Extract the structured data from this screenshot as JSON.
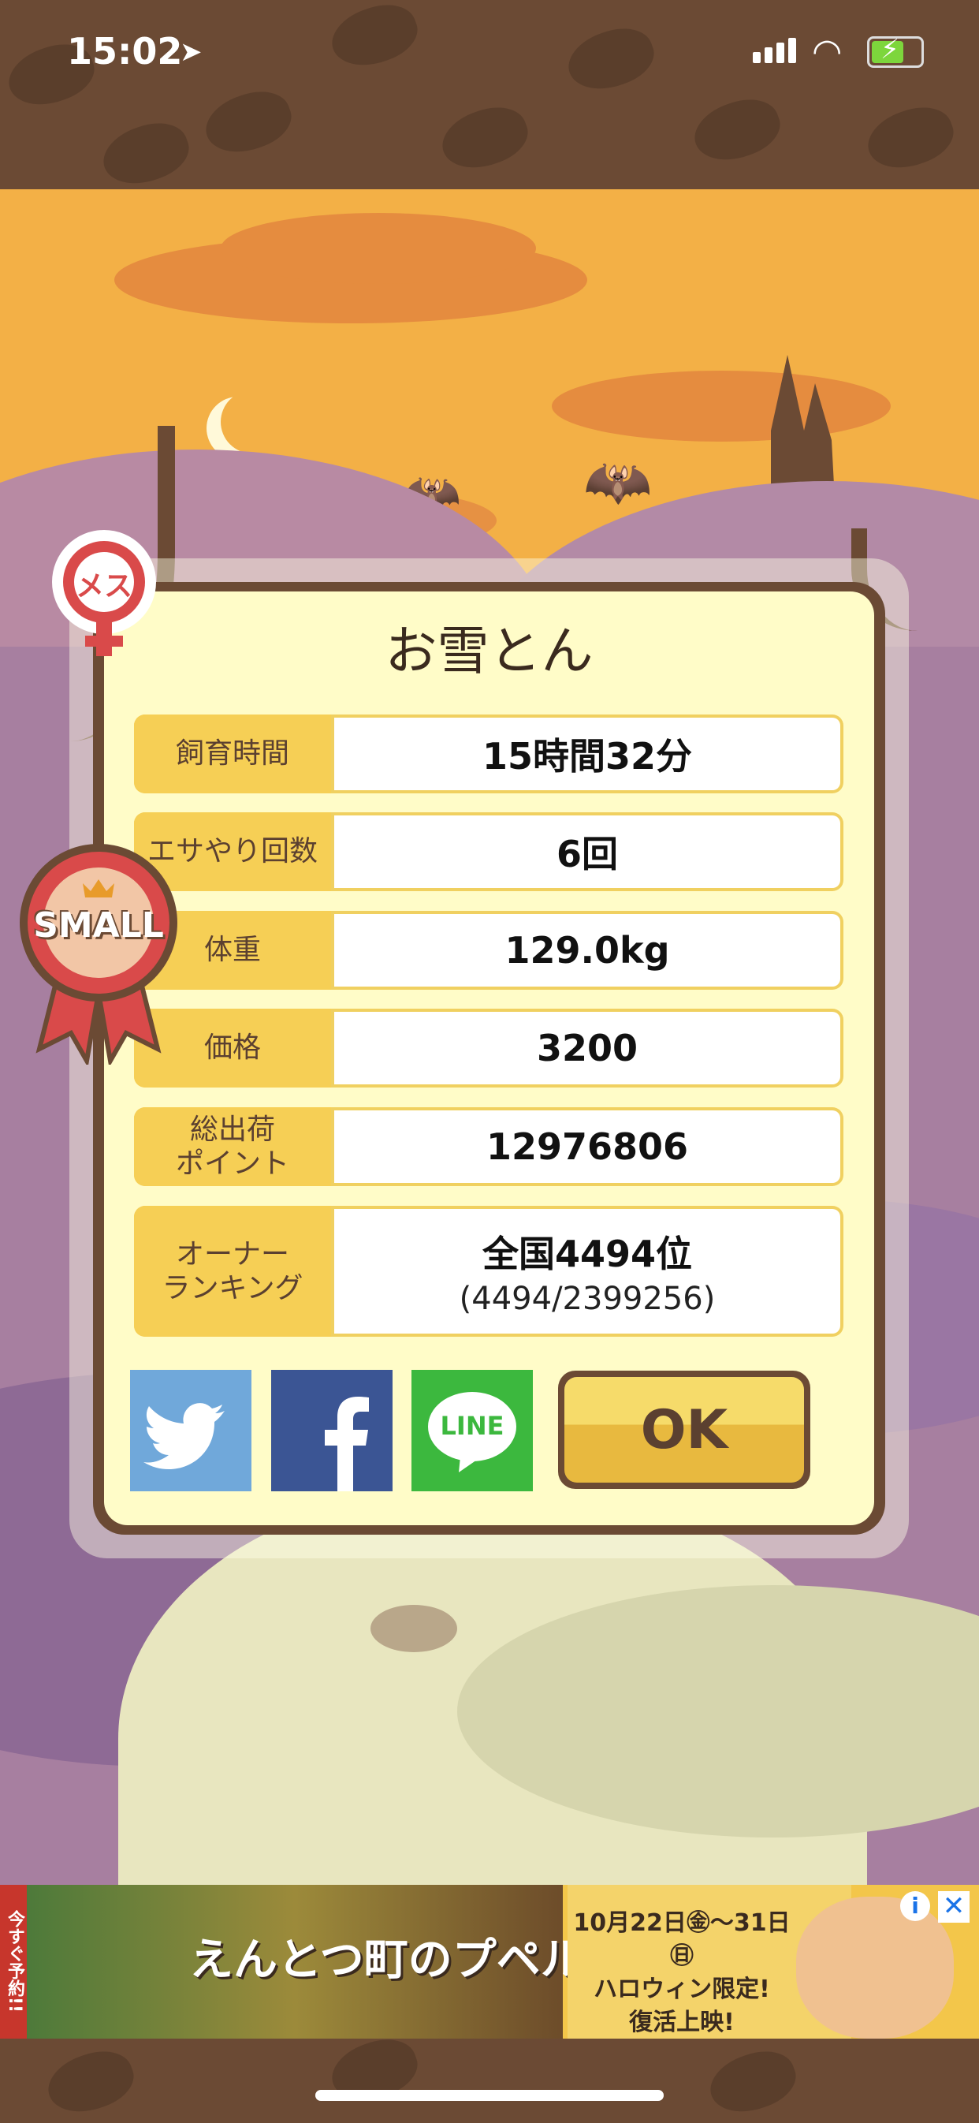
{
  "status_bar": {
    "time": "15:02",
    "icons": [
      "location-arrow-icon",
      "cellular-signal-icon",
      "wifi-icon",
      "battery-charging-icon"
    ]
  },
  "dialog": {
    "title": "お雪とん",
    "rows": [
      {
        "label": "飼育時間",
        "value": "15時間32分"
      },
      {
        "label": "エサやり回数",
        "value": "6回"
      },
      {
        "label": "体重",
        "value": "129.0kg"
      },
      {
        "label": "価格",
        "value": "3200"
      },
      {
        "label": "総出荷\nポイント",
        "value": "12976806"
      },
      {
        "label": "オーナー\nランキング",
        "value": "全国4494位",
        "sub": "(4494/2399256)"
      }
    ],
    "share": {
      "line_label": "LINE"
    },
    "ok_label": "OK"
  },
  "badges": {
    "gender": "メス",
    "size": "SMALL"
  },
  "ad": {
    "side_text": "今すぐ予約!!",
    "title": "えんとつ町のプペル",
    "dates": "10月22日㊎〜31日㊐",
    "line2": "ハロウィン限定!",
    "line3": "復活上映!"
  },
  "colors": {
    "sky": "#f3b046",
    "card_border": "#6b4a34",
    "card_bg": "#fffcc8",
    "label_bg": "#f6cf55",
    "twitter": "#70a8da",
    "facebook": "#3b5594",
    "line": "#3cb83e"
  }
}
